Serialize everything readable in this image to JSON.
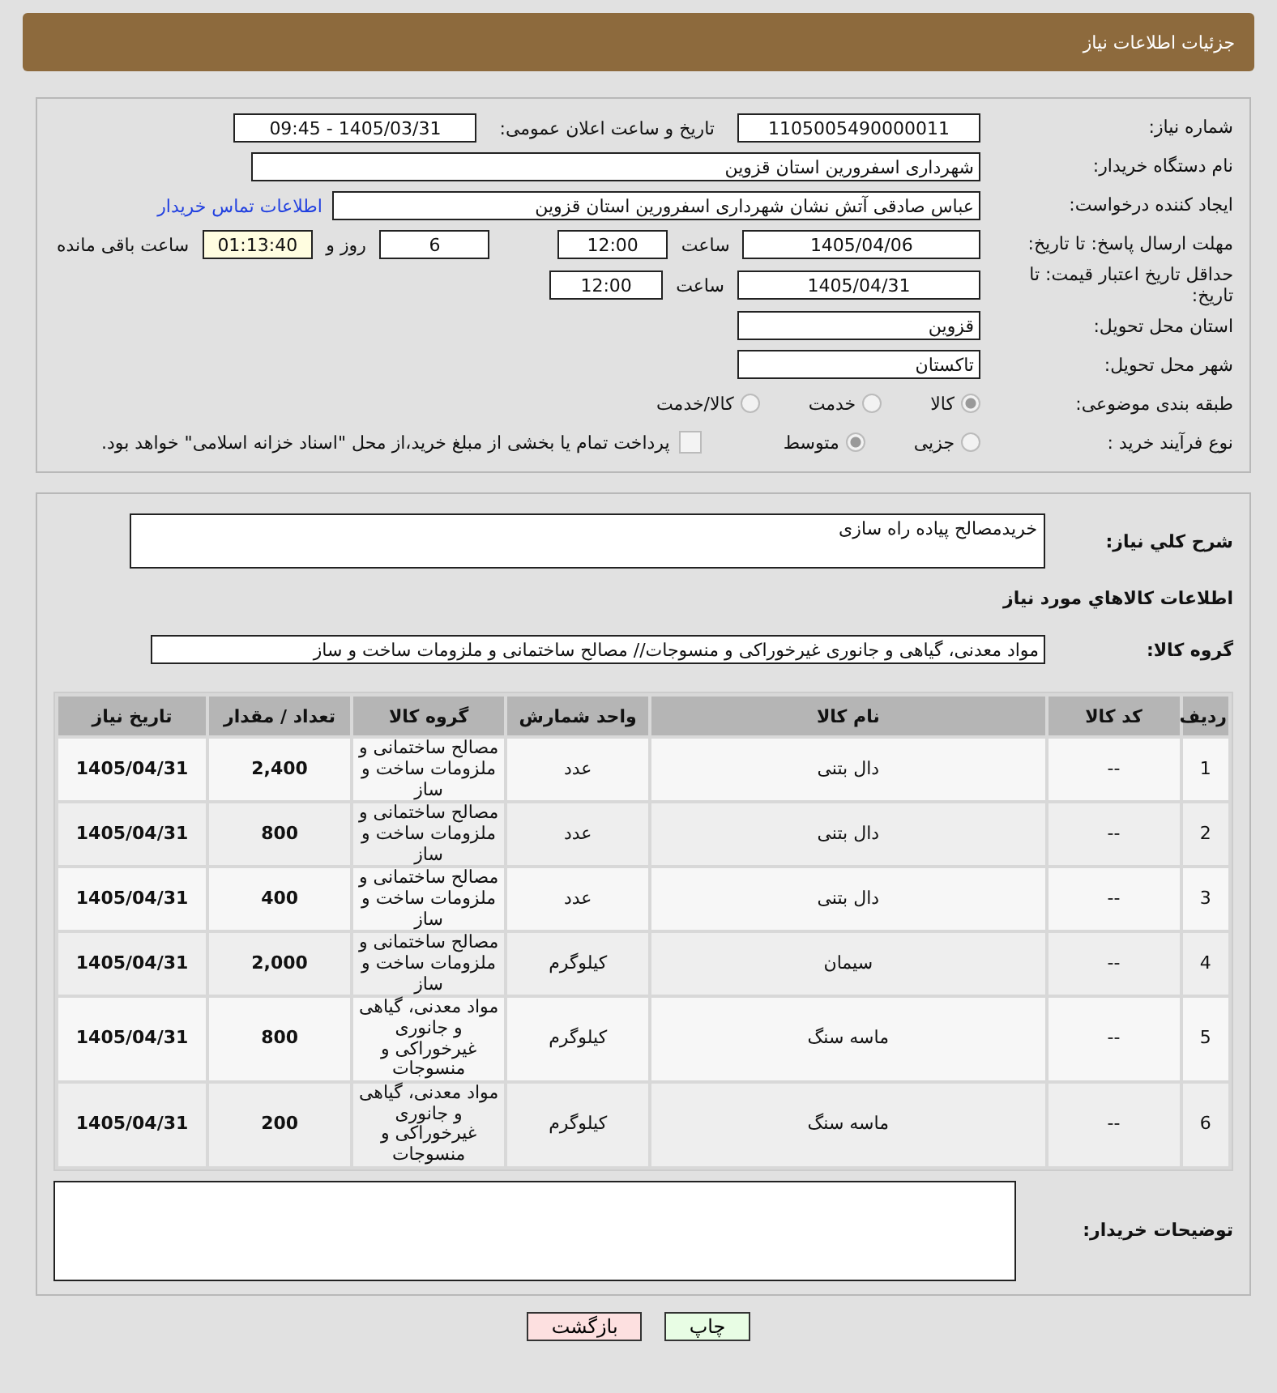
{
  "header": {
    "title": "جزئیات اطلاعات نیاز"
  },
  "need_number": {
    "label": "شماره نیاز:",
    "value": "1105005490000011"
  },
  "announce": {
    "label": "تاریخ و ساعت اعلان عمومی:",
    "value": "1405/03/31 - 09:45"
  },
  "buyer_org": {
    "label": "نام دستگاه خریدار:",
    "value": "شهرداری اسفرورین استان قزوین"
  },
  "requester": {
    "label": "ایجاد کننده درخواست:",
    "value": "عباس صادقی آتش نشان شهرداری اسفرورین استان قزوین",
    "link": "اطلاعات تماس خریدار"
  },
  "reply_deadline": {
    "label": "مهلت ارسال پاسخ: تا تاریخ:",
    "date": "1405/04/06",
    "time_label": "ساعت",
    "time": "12:00",
    "days": "6",
    "days_label": "روز و",
    "remaining": "01:13:40",
    "remaining_label": "ساعت باقی مانده"
  },
  "price_validity": {
    "label": "حداقل تاریخ اعتبار قیمت: تا تاریخ:",
    "date": "1405/04/31",
    "time_label": "ساعت",
    "time": "12:00"
  },
  "province": {
    "label": "استان محل تحویل:",
    "value": "قزوین"
  },
  "city": {
    "label": "شهر محل تحویل:",
    "value": "تاکستان"
  },
  "category": {
    "label": "طبقه بندی موضوعی:",
    "options": [
      {
        "label": "کالا",
        "selected": true
      },
      {
        "label": "خدمت",
        "selected": false
      },
      {
        "label": "کالا/خدمت",
        "selected": false
      }
    ]
  },
  "process": {
    "label": "نوع فرآیند خرید :",
    "options": [
      {
        "label": "جزیی",
        "selected": false
      },
      {
        "label": "متوسط",
        "selected": true
      }
    ],
    "payment": {
      "label": "پرداخت تمام یا بخشی از مبلغ خرید،از محل \"اسناد خزانه اسلامی\" خواهد بود.",
      "checked": false
    }
  },
  "description": {
    "label": "شرح كلي نياز:",
    "value": "خریدمصالح پیاده راه سازی"
  },
  "goods_title": "اطلاعات كالاهاي مورد نياز",
  "goods_group": {
    "label": "گروه کالا:",
    "value": "مواد معدنی، گیاهی و جانوری غیرخوراکی و منسوجات// مصالح ساختمانی و ملزومات ساخت و ساز"
  },
  "table": {
    "columns": [
      "ردیف",
      "کد کالا",
      "نام کالا",
      "واحد شمارش",
      "گروه کالا",
      "تعداد / مقدار",
      "تاریخ نیاز"
    ],
    "rows": [
      [
        "1",
        "--",
        "دال بتنی",
        "عدد",
        "مصالح ساختمانی و ملزومات ساخت و ساز",
        "2,400",
        "1405/04/31"
      ],
      [
        "2",
        "--",
        "دال بتنی",
        "عدد",
        "مصالح ساختمانی و ملزومات ساخت و ساز",
        "800",
        "1405/04/31"
      ],
      [
        "3",
        "--",
        "دال بتنی",
        "عدد",
        "مصالح ساختمانی و ملزومات ساخت و ساز",
        "400",
        "1405/04/31"
      ],
      [
        "4",
        "--",
        "سیمان",
        "کیلوگرم",
        "مصالح ساختمانی و ملزومات ساخت و ساز",
        "2,000",
        "1405/04/31"
      ],
      [
        "5",
        "--",
        "ماسه سنگ",
        "کیلوگرم",
        "مواد معدنی، گیاهی و جانوری غیرخوراکی و منسوجات",
        "800",
        "1405/04/31"
      ],
      [
        "6",
        "--",
        "ماسه سنگ",
        "کیلوگرم",
        "مواد معدنی، گیاهی و جانوری غیرخوراکی و منسوجات",
        "200",
        "1405/04/31"
      ]
    ]
  },
  "buyer_notes": {
    "label": "توضیحات خریدار:"
  },
  "buttons": [
    {
      "label": "چاپ",
      "kind": "print"
    },
    {
      "label": "بازگشت",
      "kind": "back"
    }
  ]
}
